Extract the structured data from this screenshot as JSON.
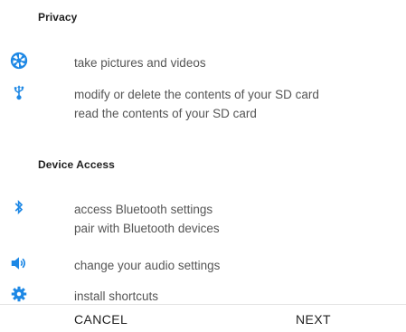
{
  "sections": [
    {
      "title": "Privacy",
      "items": [
        {
          "icon": "camera-shutter-icon",
          "lines": [
            "take pictures and videos"
          ]
        },
        {
          "icon": "usb-icon",
          "lines": [
            "modify or delete the contents of your SD card",
            "read the contents of your SD card"
          ]
        }
      ]
    },
    {
      "title": "Device Access",
      "items": [
        {
          "icon": "bluetooth-icon",
          "lines": [
            "access Bluetooth settings",
            "pair with Bluetooth devices"
          ]
        },
        {
          "icon": "speaker-icon",
          "lines": [
            "change your audio settings"
          ]
        },
        {
          "icon": "gear-icon",
          "lines": [
            "install shortcuts"
          ]
        }
      ]
    }
  ],
  "buttons": {
    "cancel": "CANCEL",
    "next": "NEXT"
  },
  "colors": {
    "icon": "#1e88e5",
    "text": "#555555",
    "title": "#212121"
  }
}
